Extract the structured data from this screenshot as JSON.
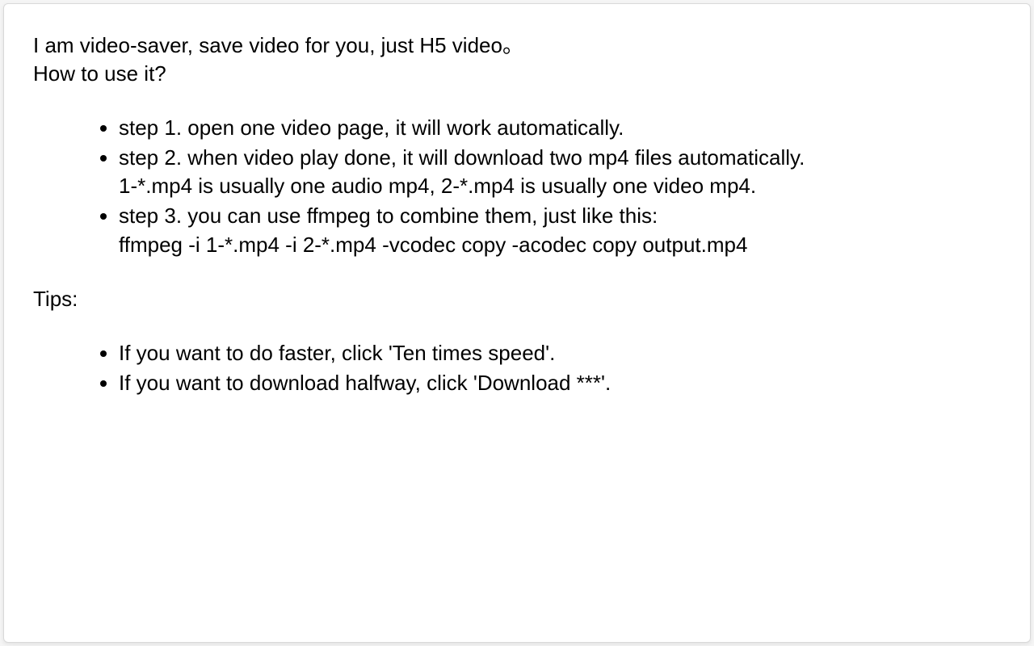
{
  "intro": {
    "line1": "I am video-saver, save video for you, just H5 video。",
    "line2": "How to use it?"
  },
  "steps": [
    {
      "line1": "step 1. open one video page, it will work automatically."
    },
    {
      "line1": "step 2. when video play done, it will download two mp4 files automatically.",
      "line2": "1-*.mp4 is usually one audio mp4, 2-*.mp4 is usually one video mp4."
    },
    {
      "line1": "step 3. you can use ffmpeg to combine them, just like this:",
      "line2": "ffmpeg -i 1-*.mp4 -i 2-*.mp4 -vcodec copy -acodec copy output.mp4"
    }
  ],
  "tips_heading": "Tips:",
  "tips": [
    "If you want to do faster, click 'Ten times speed'.",
    "If you want to download halfway, click 'Download ***'."
  ]
}
